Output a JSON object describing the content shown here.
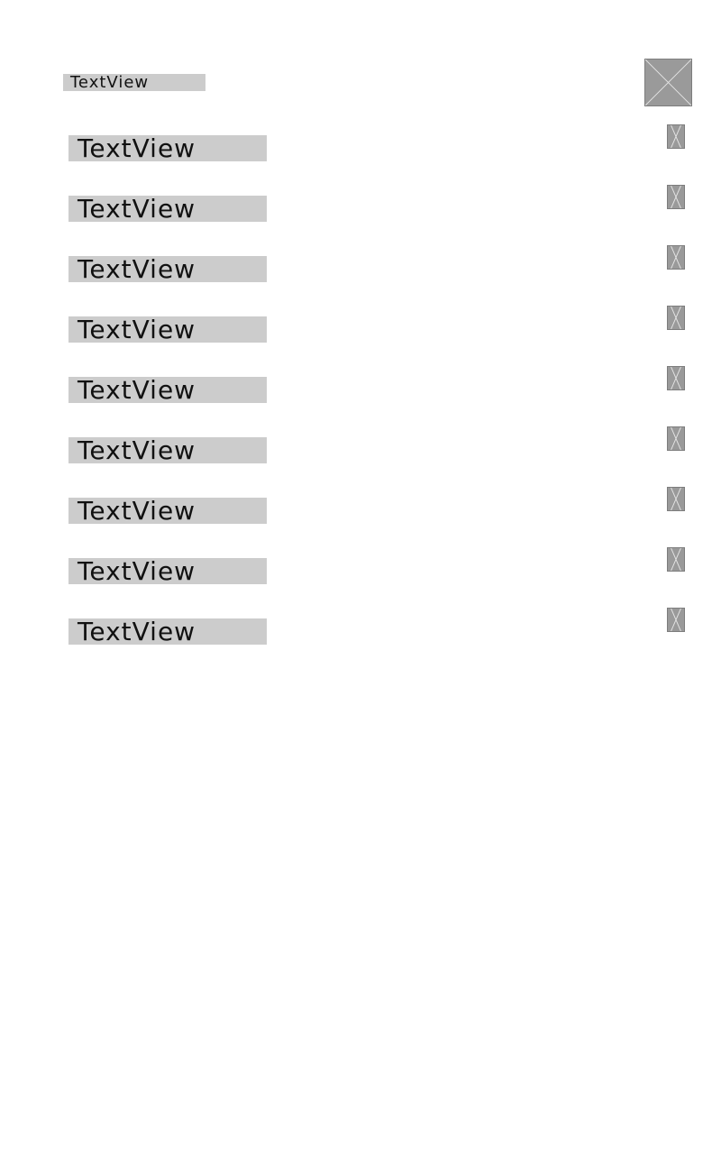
{
  "header": {
    "title": "TextView",
    "image_icon": "image-placeholder-icon"
  },
  "list": {
    "items": [
      {
        "label": "TextView",
        "icon": "image-placeholder-icon"
      },
      {
        "label": "TextView",
        "icon": "image-placeholder-icon"
      },
      {
        "label": "TextView",
        "icon": "image-placeholder-icon"
      },
      {
        "label": "TextView",
        "icon": "image-placeholder-icon"
      },
      {
        "label": "TextView",
        "icon": "image-placeholder-icon"
      },
      {
        "label": "TextView",
        "icon": "image-placeholder-icon"
      },
      {
        "label": "TextView",
        "icon": "image-placeholder-icon"
      },
      {
        "label": "TextView",
        "icon": "image-placeholder-icon"
      },
      {
        "label": "TextView",
        "icon": "image-placeholder-icon"
      }
    ]
  },
  "colors": {
    "textview_background": "#cccccc",
    "image_placeholder": "#9a9a9a",
    "page_background": "#ffffff"
  }
}
